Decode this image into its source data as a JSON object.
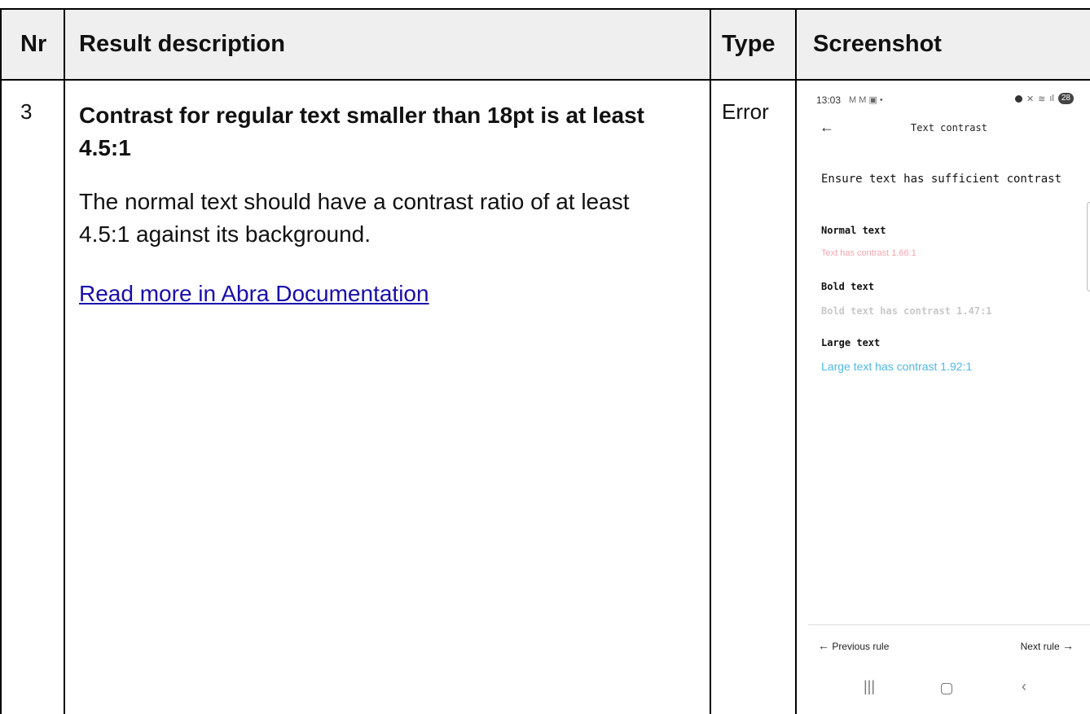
{
  "table": {
    "headers": {
      "nr": "Nr",
      "description": "Result description",
      "type": "Type",
      "screenshot": "Screenshot"
    },
    "row": {
      "nr": "3",
      "title": "Contrast for regular text smaller than 18pt is at least 4.5:1",
      "body": "The normal text should have a contrast ratio of at least 4.5:1 against its background.",
      "link": "Read more in Abra Documentation",
      "type": "Error"
    }
  },
  "phone": {
    "status_time": "13:03",
    "status_icons": "M M ▣ •",
    "battery": "28",
    "app_title": "Text contrast",
    "heading": "Ensure text has sufficient contrast",
    "sections": {
      "normal_label": "Normal text",
      "normal_sample": "Text has contrast 1.66:1",
      "bold_label": "Bold text",
      "bold_sample": "Bold text has contrast 1.47:1",
      "large_label": "Large text",
      "large_sample": "Large text has contrast 1.92:1"
    },
    "prev_rule": "Previous rule",
    "next_rule": "Next rule",
    "colors": {
      "normal_sample": "#f4a6b0",
      "bold_sample": "#c8c8c8",
      "large_sample": "#4fb8e6"
    }
  }
}
